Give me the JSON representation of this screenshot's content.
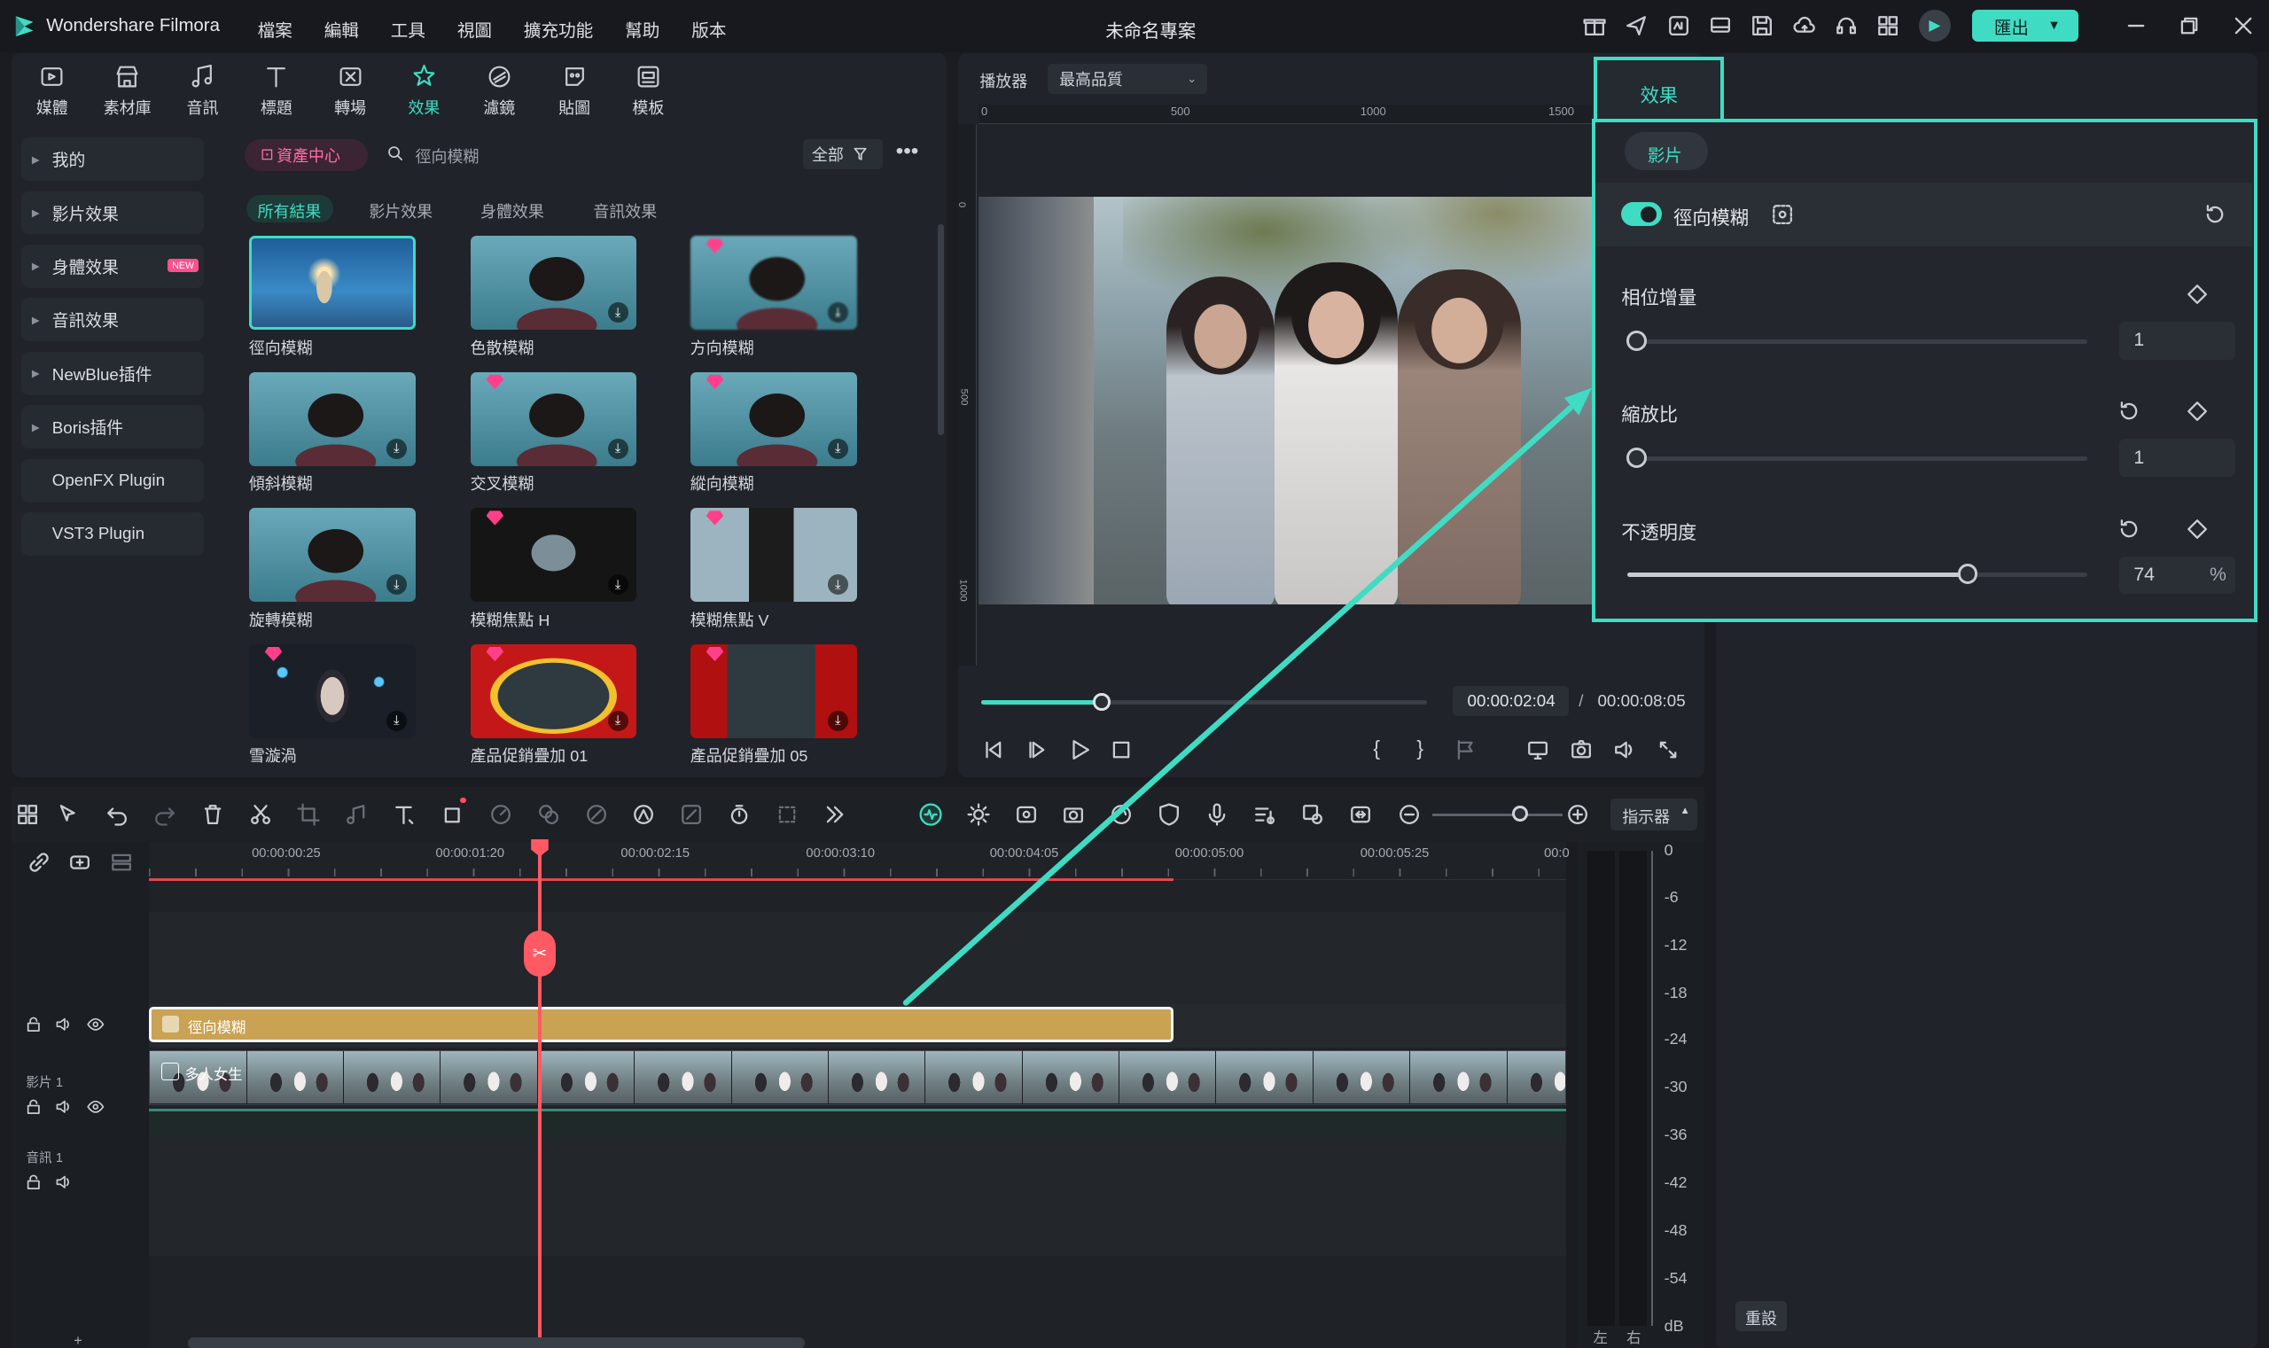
{
  "app": {
    "name": "Wondershare Filmora",
    "project_title": "未命名專案",
    "export_label": "匯出"
  },
  "menu": [
    "檔案",
    "編輯",
    "工具",
    "視圖",
    "擴充功能",
    "幫助",
    "版本"
  ],
  "tool_tabs": [
    {
      "label": "媒體",
      "icon": "media-icon"
    },
    {
      "label": "素材庫",
      "icon": "store-icon"
    },
    {
      "label": "音訊",
      "icon": "music-icon"
    },
    {
      "label": "標題",
      "icon": "title-icon"
    },
    {
      "label": "轉場",
      "icon": "transition-icon"
    },
    {
      "label": "效果",
      "icon": "effects-icon",
      "active": true
    },
    {
      "label": "濾鏡",
      "icon": "filter-icon"
    },
    {
      "label": "貼圖",
      "icon": "sticker-icon"
    },
    {
      "label": "模板",
      "icon": "template-icon"
    }
  ],
  "sidebar": [
    {
      "label": "我的",
      "arrow": true
    },
    {
      "label": "影片效果",
      "arrow": true
    },
    {
      "label": "身體效果",
      "arrow": true,
      "badge": "NEW"
    },
    {
      "label": "音訊效果",
      "arrow": true
    },
    {
      "label": "NewBlue插件",
      "arrow": true
    },
    {
      "label": "Boris插件",
      "arrow": true
    },
    {
      "label": "OpenFX Plugin",
      "arrow": false
    },
    {
      "label": "VST3 Plugin",
      "arrow": false
    }
  ],
  "library": {
    "asset_center": "資產中心",
    "search_value": "徑向模糊",
    "filter_label": "全部",
    "filter_tabs": [
      "所有結果",
      "影片效果",
      "身體效果",
      "音訊效果"
    ],
    "effects": [
      {
        "name": "徑向模糊",
        "premium": false,
        "selected": true
      },
      {
        "name": "色散模糊",
        "premium": false
      },
      {
        "name": "方向模糊",
        "premium": true
      },
      {
        "name": "傾斜模糊",
        "premium": false
      },
      {
        "name": "交叉模糊",
        "premium": true
      },
      {
        "name": "縱向模糊",
        "premium": true
      },
      {
        "name": "旋轉模糊",
        "premium": false
      },
      {
        "name": "模糊焦點 H",
        "premium": true
      },
      {
        "name": "模糊焦點 V",
        "premium": true
      },
      {
        "name": "雪漩渦",
        "premium": true
      },
      {
        "name": "產品促銷疊加 01",
        "premium": true
      },
      {
        "name": "產品促銷疊加 05",
        "premium": true
      }
    ]
  },
  "player": {
    "label": "播放器",
    "quality": "最高品質",
    "ruler_ticks": [
      "0",
      "500",
      "1000",
      "1500"
    ],
    "vruler_ticks": [
      "0",
      "500",
      "1000"
    ],
    "current_time": "00:00:02:04",
    "separator": "/",
    "total_time": "00:00:08:05",
    "progress": 0.27
  },
  "effects_panel": {
    "tab": "效果",
    "subtab": "影片",
    "effect_name": "徑向模糊",
    "enabled": true,
    "params": [
      {
        "label": "相位增量",
        "value": "1",
        "fraction": 0.02
      },
      {
        "label": "縮放比",
        "value": "1",
        "fraction": 0.02
      },
      {
        "label": "不透明度",
        "value": "74",
        "unit": "%",
        "fraction": 0.74
      }
    ],
    "reset_label": "重設"
  },
  "timeline": {
    "indicator_label": "指示器",
    "ruler": [
      "00:00:00:25",
      "00:00:01:20",
      "00:00:02:15",
      "00:00:03:10",
      "00:00:04:05",
      "00:00:05:00",
      "00:00:05:25",
      "00:0"
    ],
    "effect_clip_label": "徑向模糊",
    "video_track_label": "影片 1",
    "audio_track_label": "音訊 1",
    "clip_label": "多人女生"
  },
  "vu_meter": {
    "scale": [
      "0",
      "-6",
      "-12",
      "-18",
      "-24",
      "-30",
      "-36",
      "-42",
      "-48",
      "-54",
      "dB"
    ],
    "left": "左",
    "right": "右"
  },
  "colors": {
    "accent": "#3fdcc3",
    "playhead": "#ff5a64",
    "effect_clip": "#c9a254",
    "asset_center": "#ff6fa8"
  }
}
